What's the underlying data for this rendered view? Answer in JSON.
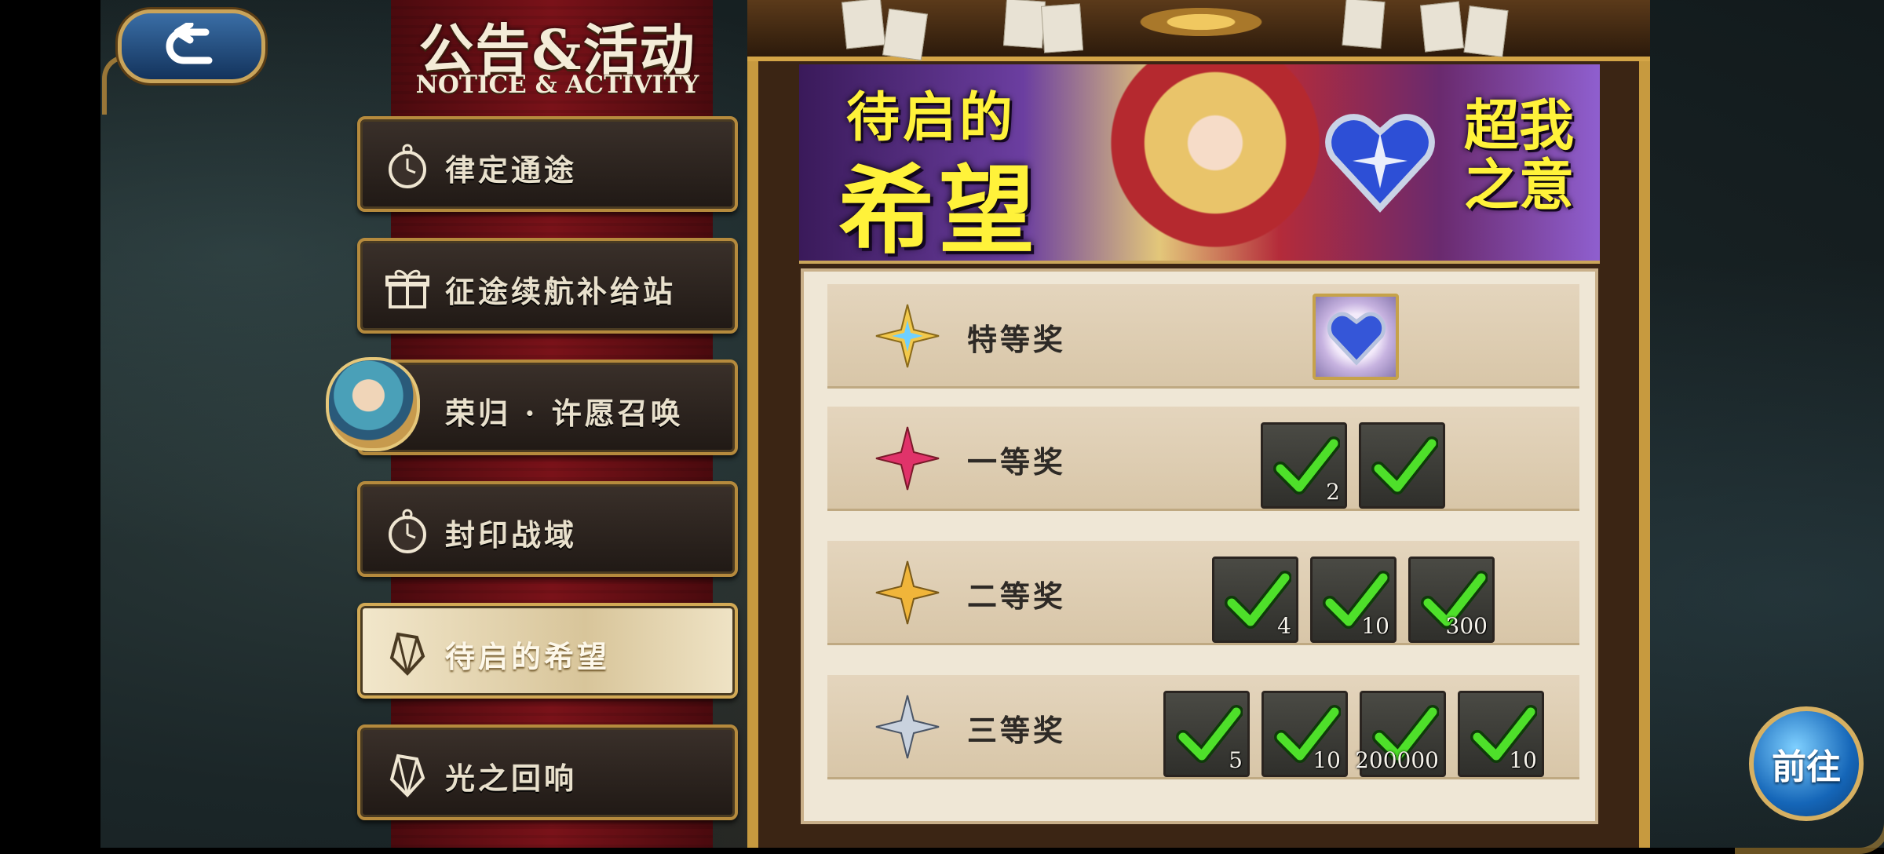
{
  "header": {
    "back_label": "",
    "title_zh": "公告&活动",
    "title_en": "NOTICE & ACTIVITY"
  },
  "menu": {
    "items": [
      {
        "label": "律定通途",
        "icon": "pocket-watch-icon"
      },
      {
        "label": "征途续航补给站",
        "icon": "gift-box-icon"
      },
      {
        "label": "荣归 · 许愿召唤",
        "icon": "character-avatar-icon"
      },
      {
        "label": "封印战域",
        "icon": "pocket-watch-icon"
      },
      {
        "label": "待启的希望",
        "icon": "crystal-icon",
        "active": true
      },
      {
        "label": "光之回响",
        "icon": "crystal-icon"
      }
    ]
  },
  "event": {
    "banner_title_a": "待启的",
    "banner_title_b": "希望",
    "banner_subtitle": "超我之意",
    "prizes": [
      {
        "rank": "特等奖",
        "items": [
          {
            "qty": ""
          }
        ]
      },
      {
        "rank": "一等奖",
        "items": [
          {
            "qty": "2"
          },
          {
            "qty": ""
          }
        ]
      },
      {
        "rank": "二等奖",
        "items": [
          {
            "qty": "4"
          },
          {
            "qty": "10"
          },
          {
            "qty": "300"
          }
        ]
      },
      {
        "rank": "三等奖",
        "items": [
          {
            "qty": "5"
          },
          {
            "qty": "10"
          },
          {
            "qty": "200000"
          },
          {
            "qty": "10"
          }
        ]
      }
    ]
  },
  "actions": {
    "go_label": "前往"
  },
  "colors": {
    "accent_gold": "#c79a3f",
    "banner_red": "#7a1219",
    "check_green": "#4ee02a",
    "go_button_blue": "#1566b8"
  }
}
